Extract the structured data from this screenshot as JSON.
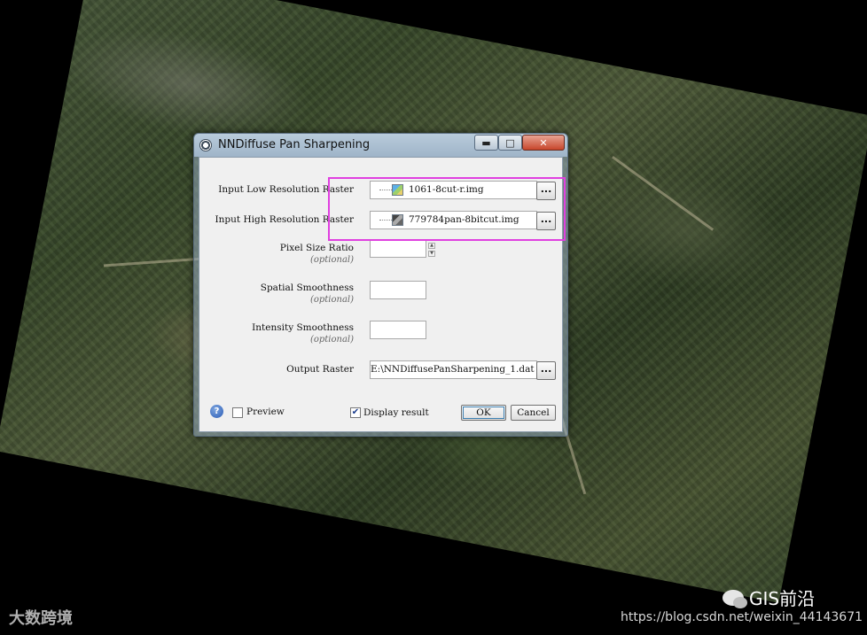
{
  "dialog": {
    "title": "NNDiffuse Pan Sharpening",
    "window_buttons": {
      "minimize": "▬",
      "maximize": "□",
      "close": "✕"
    }
  },
  "fields": {
    "low_res": {
      "label": "Input Low Resolution Raster",
      "value": "1061-8cut-r.img",
      "icon": "multiband-raster-icon"
    },
    "high_res": {
      "label": "Input High Resolution Raster",
      "value": "779784pan-8bitcut.img",
      "icon": "grayscale-raster-icon"
    },
    "pixel_ratio": {
      "label": "Pixel Size Ratio",
      "optional": "(optional)",
      "value": ""
    },
    "spatial": {
      "label": "Spatial Smoothness",
      "optional": "(optional)",
      "value": ""
    },
    "intensity": {
      "label": "Intensity Smoothness",
      "optional": "(optional)",
      "value": ""
    },
    "output": {
      "label": "Output Raster",
      "value": "E:\\NNDiffusePanSharpening_1.dat"
    },
    "browse_label": "..."
  },
  "footer": {
    "help": "?",
    "preview_label": "Preview",
    "preview_checked": false,
    "display_label": "Display result",
    "display_checked": true,
    "ok_label": "OK",
    "cancel_label": "Cancel"
  },
  "watermarks": {
    "left": "大数跨境",
    "right": "GIS前沿",
    "url": "https://blog.csdn.net/weixin_44143671"
  },
  "colors": {
    "highlight": "#e040e0",
    "close_button": "#c7452b",
    "titlebar": "#b9cbdb"
  }
}
